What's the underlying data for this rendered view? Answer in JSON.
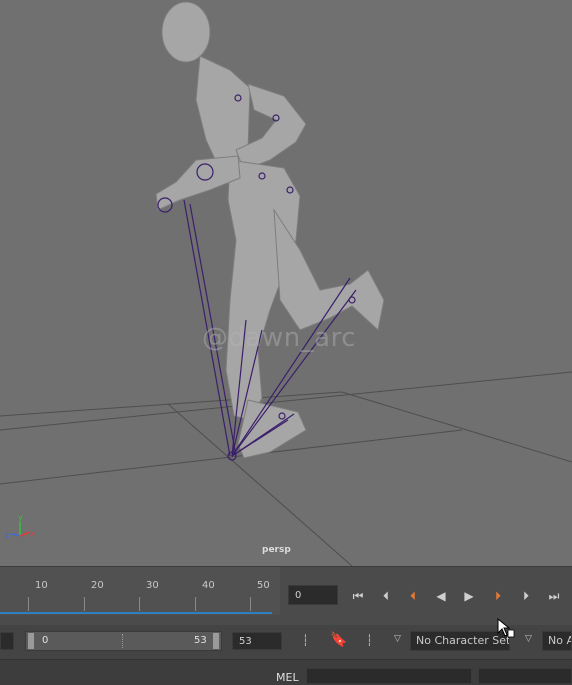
{
  "viewport": {
    "camera_label": "persp",
    "watermark": "@dawn_arc",
    "axis_labels": {
      "x": "x",
      "y": "y",
      "z": "z"
    }
  },
  "timeline": {
    "ticks": [
      "10",
      "20",
      "30",
      "40",
      "50"
    ],
    "current_frame": "0"
  },
  "playback": {
    "buttons": [
      {
        "name": "go-to-start-button",
        "glyph": "⏮"
      },
      {
        "name": "step-back-frame-button",
        "glyph": "⏴"
      },
      {
        "name": "step-back-key-button",
        "glyph": "⏴"
      },
      {
        "name": "play-backwards-button",
        "glyph": "◀"
      },
      {
        "name": "play-forwards-button",
        "glyph": "▶"
      },
      {
        "name": "step-forward-key-button",
        "glyph": "⏵"
      },
      {
        "name": "step-forward-frame-button",
        "glyph": "⏵"
      },
      {
        "name": "go-to-end-button",
        "glyph": "⏭"
      }
    ]
  },
  "range": {
    "start_inner": "0",
    "end_inner": "53",
    "end_outer": "53"
  },
  "character_set": {
    "label": "No Character Set"
  },
  "anim_layer": {
    "label": "No A"
  },
  "command_line": {
    "language_label": "MEL"
  },
  "colors": {
    "viewport_bg": "#707070",
    "timeline_accent": "#2e7fc1",
    "key_accent": "#e07a3a",
    "rig_lines": "#3b1f6b"
  }
}
